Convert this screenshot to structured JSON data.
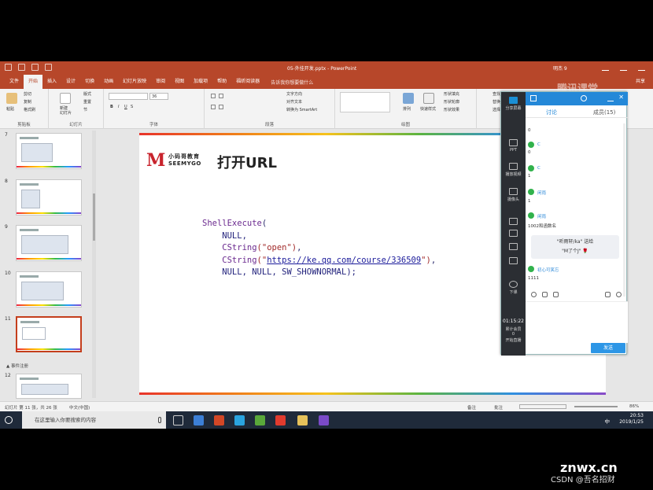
{
  "powerpoint": {
    "doc_title": "05-外挂开发.pptx - PowerPoint",
    "user": "明杰 9",
    "tabs": [
      "文件",
      "开始",
      "插入",
      "设计",
      "切换",
      "动画",
      "幻灯片放映",
      "审阅",
      "视图",
      "加载项",
      "帮助",
      "福昕阅读器"
    ],
    "active_tab": "开始",
    "tell_me": "告诉我你想要做什么",
    "share": "共享",
    "ribbon": {
      "clipboard": {
        "paste": "粘贴",
        "cut": "剪切",
        "copy": "复制",
        "format_painter": "格式刷",
        "group": "剪贴板"
      },
      "slides": {
        "new_slide": "新建\n幻灯片",
        "layout": "版式",
        "reset": "重置",
        "section": "节",
        "group": "幻灯片"
      },
      "font": {
        "size": "36",
        "group": "字体"
      },
      "paragraph": {
        "text_direction": "文字方向",
        "align_text": "对齐文本",
        "smartart": "转换为 SmartArt",
        "group": "段落"
      },
      "drawing": {
        "arrange": "排列",
        "quick_styles": "快速样式",
        "shape_fill": "形状填充",
        "shape_outline": "形状轮廓",
        "shape_effects": "形状效果",
        "group": "绘图"
      },
      "editing": {
        "find": "查找",
        "replace": "替换",
        "select": "选择"
      }
    },
    "thumbnails": [
      {
        "num": "7",
        "selected": false
      },
      {
        "num": "8",
        "selected": false
      },
      {
        "num": "9",
        "selected": false
      },
      {
        "num": "10",
        "selected": false
      },
      {
        "num": "11",
        "selected": true
      },
      {
        "num": "12",
        "selected": false
      }
    ],
    "section_label": "▲ 事件注册",
    "slide": {
      "logo_mark": "M",
      "logo_cn": "小码哥教育",
      "logo_en": "SEEMYGO",
      "title": "打开URL",
      "code": {
        "l1_fn": "ShellExecute",
        "l1_rest": "(",
        "l2": "    NULL,",
        "l3_fn": "    CString",
        "l3_str": "(\"open\")",
        "l3_end": ",",
        "l4_fn": "    CString",
        "l4_pre": "(\"",
        "l4_url": "https://ke.qq.com/course/336509",
        "l4_post": "\")",
        "l4_end": ",",
        "l5": "    NULL, NULL, SW_SHOWNORMAL);"
      }
    },
    "status": {
      "slide_info": "幻灯片 第 11 张，共 26 张",
      "language": "中文(中国)",
      "notes": "备注",
      "comments": "批注",
      "zoom": "86%"
    }
  },
  "tencent_panel": {
    "brand": "腾讯课堂",
    "sidebar": [
      "分享屏幕",
      "PPT",
      "播放视频",
      "摄像头",
      "",
      "",
      "",
      "下课"
    ],
    "timer": "01:15:22",
    "timer_sub": [
      "累计会员",
      "0",
      "开始直播"
    ],
    "tab_discussion": "讨论",
    "tab_members": "成员(15)",
    "messages": [
      {
        "who": "",
        "text": "0"
      },
      {
        "who": "C",
        "text": "0"
      },
      {
        "who": "C",
        "text": "1"
      },
      {
        "who": "闲雨",
        "text": "1"
      },
      {
        "who": "闲雨",
        "text": "1002和函数名"
      }
    ],
    "gift_line1": "\"听雨轩/ka\" 送给",
    "gift_line2": "\"M了个J\" 🌹",
    "last_who": "初心可笑忘",
    "last_text": "1111",
    "send": "发送"
  },
  "taskbar": {
    "search_placeholder": "在这里输入你要搜索的内容",
    "ime": "中",
    "time": "20:53",
    "date": "2019/1/25"
  },
  "watermark": {
    "site": "znwx.cn",
    "csdn": "CSDN @吾名招财"
  }
}
